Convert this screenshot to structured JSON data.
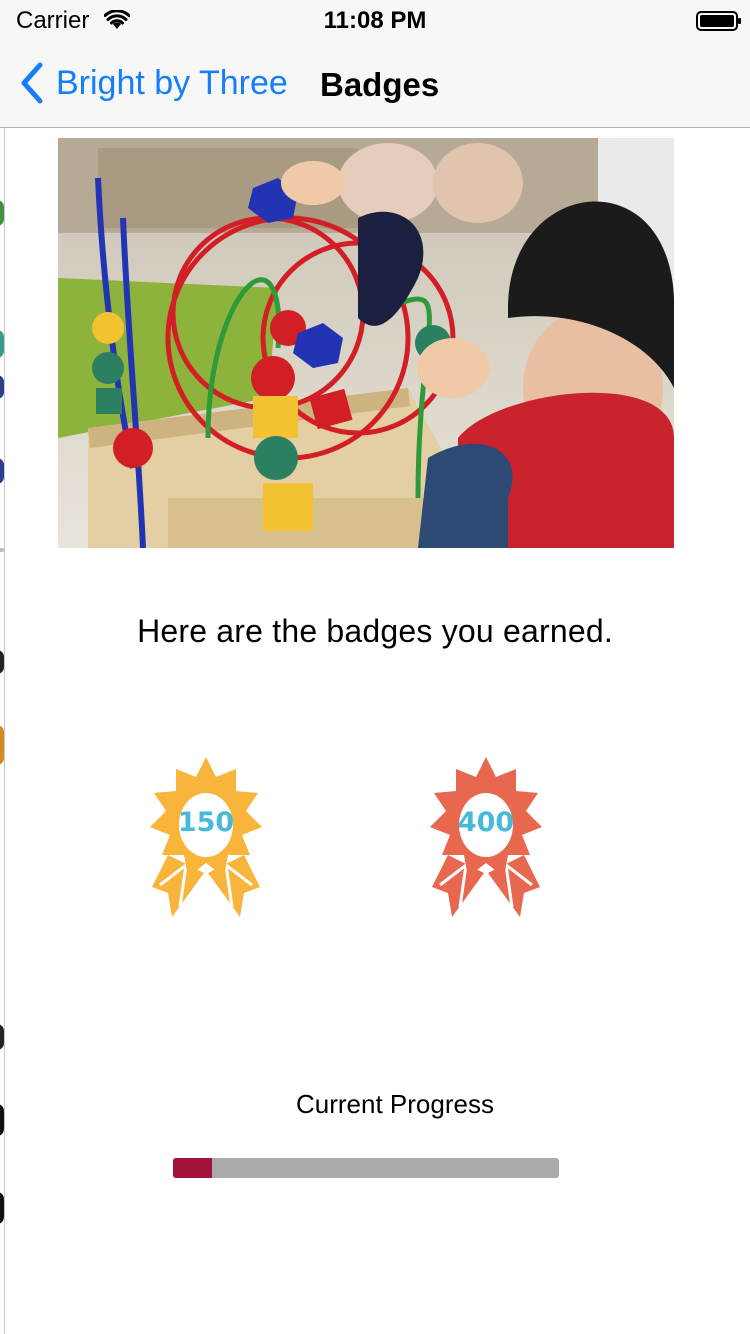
{
  "status_bar": {
    "carrier": "Carrier",
    "time": "11:08 PM"
  },
  "nav": {
    "back_label": "Bright by Three",
    "title": "Badges"
  },
  "intro_text": "Here are the badges you earned.",
  "badges": [
    {
      "value": "150",
      "color": "#f9b43b"
    },
    {
      "value": "400",
      "color": "#e8684f"
    }
  ],
  "progress": {
    "label": "Current Progress",
    "fraction": 0.1,
    "fill_color": "#a0143c",
    "track_color": "#aaaaab"
  },
  "colors": {
    "accent": "#147efb",
    "badge_text": "#4ab8d8"
  }
}
